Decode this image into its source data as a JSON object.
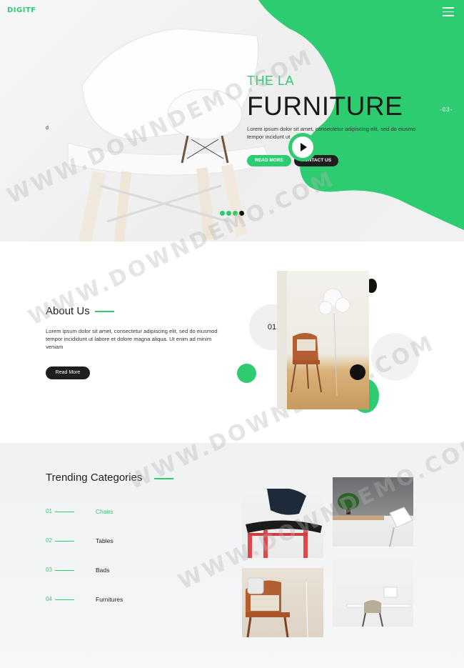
{
  "brand": {
    "logo": "DIGITF",
    "accent": "#2ecc71",
    "dark": "#1e1e1e"
  },
  "header": {
    "menu_icon": "hamburger-icon"
  },
  "hero": {
    "subtitle": "THE LA",
    "title": "FURNITURE",
    "text": "Lorem ipsum dolor sit amet, consectetur adipiscing elit, sed do eiusmo tempor incidunt ut",
    "read_more": "READ MORE",
    "contact_us": "CONTACT US",
    "side_letter": "d",
    "slide_number": "-03-",
    "play_icon": "play-icon",
    "dots": 4,
    "active_dot": 4
  },
  "about": {
    "title": "About Us",
    "text": "Lorem ipsum dolor sit amet, consectetur adipiscing elit, sed do eiusmod tempor incididunt ut labore et dolore magna aliqua. Ut enim ad minim veniam",
    "button": "Read More",
    "number": "01"
  },
  "trending": {
    "title": "Trending Categories",
    "categories": [
      {
        "num": "01",
        "name": "Chairs",
        "active": true
      },
      {
        "num": "02",
        "name": "Tables",
        "active": false
      },
      {
        "num": "03",
        "name": "Bads",
        "active": false
      },
      {
        "num": "04",
        "name": "Furnitures",
        "active": false
      }
    ]
  },
  "watermark": "WWW.DOWNDEMO.COM"
}
